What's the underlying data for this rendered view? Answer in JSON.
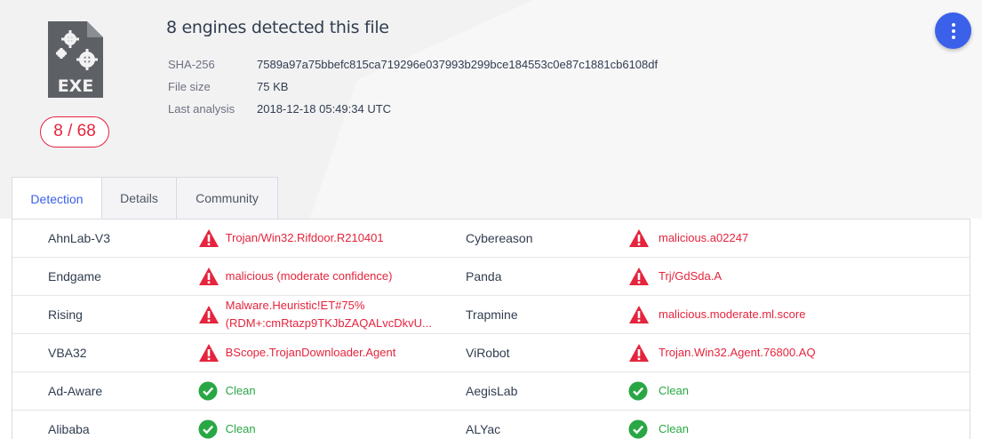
{
  "header": {
    "title": "8 engines detected this file",
    "score": "8 / 68",
    "file_type_label": "EXE",
    "meta": [
      {
        "label": "SHA-256",
        "value": "7589a97a75bbefc815ca719296e037993b299bce184553c0e87c1881cb6108df"
      },
      {
        "label": "File size",
        "value": "75 KB"
      },
      {
        "label": "Last analysis",
        "value": "2018-12-18 05:49:34 UTC"
      }
    ]
  },
  "tabs": [
    {
      "label": "Detection",
      "active": true
    },
    {
      "label": "Details",
      "active": false
    },
    {
      "label": "Community",
      "active": false
    }
  ],
  "colors": {
    "accent": "#3b61ea",
    "malicious": "#e5243d",
    "clean": "#29a744"
  },
  "detections": [
    {
      "left": {
        "engine": "AhnLab-V3",
        "status": "malicious",
        "icon": "warning-icon",
        "result": "Trojan/Win32.Rifdoor.R210401"
      },
      "right": {
        "engine": "Cybereason",
        "status": "malicious",
        "icon": "warning-icon",
        "result": "malicious.a02247"
      }
    },
    {
      "left": {
        "engine": "Endgame",
        "status": "malicious",
        "icon": "warning-icon",
        "result": "malicious (moderate confidence)"
      },
      "right": {
        "engine": "Panda",
        "status": "malicious",
        "icon": "warning-icon",
        "result": "Trj/GdSda.A"
      }
    },
    {
      "left": {
        "engine": "Rising",
        "status": "malicious",
        "icon": "warning-icon",
        "result": "Malware.Heuristic!ET#75%",
        "result2": "(RDM+:cmRtazp9TKJbZAQALvcDkvU..."
      },
      "right": {
        "engine": "Trapmine",
        "status": "malicious",
        "icon": "warning-icon",
        "result": "malicious.moderate.ml.score"
      }
    },
    {
      "left": {
        "engine": "VBA32",
        "status": "malicious",
        "icon": "warning-icon",
        "result": "BScope.TrojanDownloader.Agent"
      },
      "right": {
        "engine": "ViRobot",
        "status": "malicious",
        "icon": "warning-icon",
        "result": "Trojan.Win32.Agent.76800.AQ"
      }
    },
    {
      "left": {
        "engine": "Ad-Aware",
        "status": "clean",
        "icon": "check-circle-icon",
        "result": "Clean"
      },
      "right": {
        "engine": "AegisLab",
        "status": "clean",
        "icon": "check-circle-icon",
        "result": "Clean"
      }
    },
    {
      "left": {
        "engine": "Alibaba",
        "status": "clean",
        "icon": "check-circle-icon",
        "result": "Clean"
      },
      "right": {
        "engine": "ALYac",
        "status": "clean",
        "icon": "check-circle-icon",
        "result": "Clean"
      }
    }
  ]
}
